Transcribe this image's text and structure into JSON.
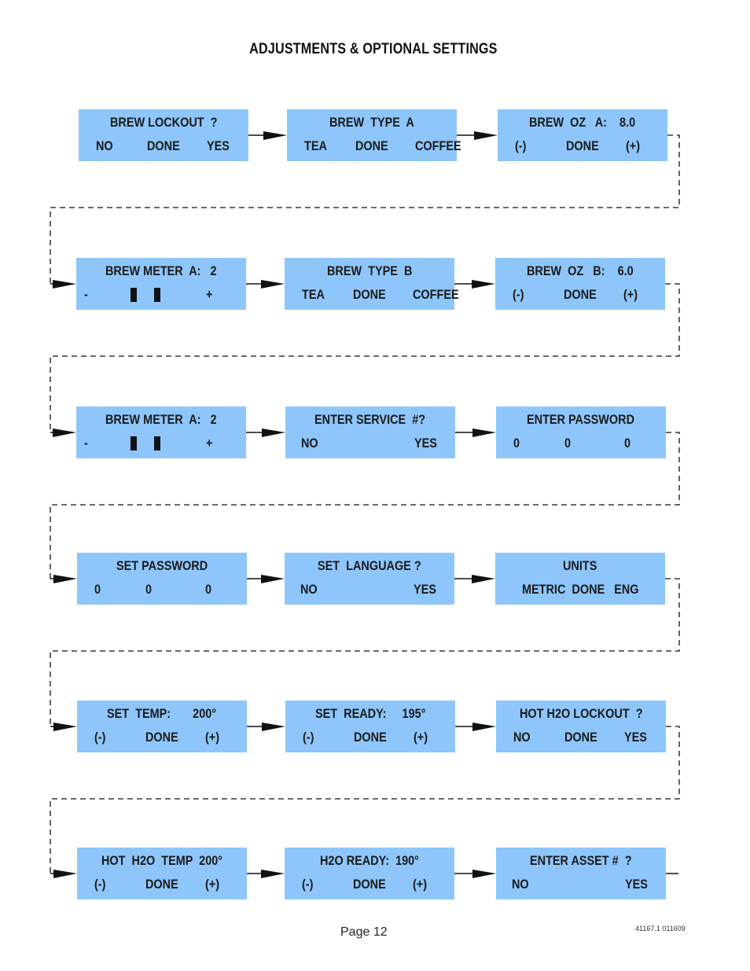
{
  "title": "ADJUSTMENTS & OPTIONAL SETTINGS",
  "screens": [
    {
      "id": "brew-lockout",
      "line1": [
        "BREW LOCKOUT  ?"
      ],
      "line2": [
        "NO",
        "DONE",
        "YES"
      ]
    },
    {
      "id": "brew-type-a",
      "line1": [
        "BREW  TYPE  A"
      ],
      "line2": [
        "TEA",
        "DONE",
        "COFFEE"
      ]
    },
    {
      "id": "brew-oz-a",
      "line1": [
        "BREW  OZ   A:    8.0"
      ],
      "line2": [
        "(-)",
        "DONE",
        "(+)"
      ]
    },
    {
      "id": "brew-meter-a-1",
      "line1": [
        "BREW METER  A:   2"
      ],
      "line2": [
        "-",
        "+"
      ],
      "meter_bars": 2
    },
    {
      "id": "brew-type-b",
      "line1": [
        "BREW  TYPE  B"
      ],
      "line2": [
        "TEA",
        "DONE",
        "COFFEE"
      ]
    },
    {
      "id": "brew-oz-b",
      "line1": [
        "BREW  OZ   B:    6.0"
      ],
      "line2": [
        "(-)",
        "DONE",
        "(+)"
      ]
    },
    {
      "id": "brew-meter-a-2",
      "line1": [
        "BREW METER  A:   2"
      ],
      "line2": [
        "-",
        "+"
      ],
      "meter_bars": 2
    },
    {
      "id": "enter-service",
      "line1": [
        "ENTER SERVICE  #?"
      ],
      "line2": [
        "NO",
        "YES"
      ]
    },
    {
      "id": "enter-password",
      "line1": [
        "ENTER PASSWORD"
      ],
      "line2": [
        "0",
        "0",
        "0"
      ]
    },
    {
      "id": "set-password",
      "line1": [
        "SET PASSWORD"
      ],
      "line2": [
        "0",
        "0",
        "0"
      ]
    },
    {
      "id": "set-language",
      "line1": [
        "SET  LANGUAGE ?"
      ],
      "line2": [
        "NO",
        "YES"
      ]
    },
    {
      "id": "units",
      "line1": [
        "UNITS"
      ],
      "line2": [
        "METRIC  DONE   ENG"
      ]
    },
    {
      "id": "set-temp",
      "line1": [
        "SET  TEMP:       200°"
      ],
      "line2": [
        "(-)",
        "DONE",
        "(+)"
      ]
    },
    {
      "id": "set-ready",
      "line1": [
        "SET  READY:     195°"
      ],
      "line2": [
        "(-)",
        "DONE",
        "(+)"
      ]
    },
    {
      "id": "hot-h2o-lockout",
      "line1": [
        "HOT H2O LOCKOUT  ?"
      ],
      "line2": [
        "NO",
        "DONE",
        "YES"
      ]
    },
    {
      "id": "hot-h2o-temp",
      "line1": [
        "HOT  H2O  TEMP  200°"
      ],
      "line2": [
        "(-)",
        "DONE",
        "(+)"
      ]
    },
    {
      "id": "h2o-ready",
      "line1": [
        "H2O READY:  190°"
      ],
      "line2": [
        "(-)",
        "DONE",
        "(+)"
      ]
    },
    {
      "id": "enter-asset",
      "line1": [
        "ENTER ASSET #  ?"
      ],
      "line2": [
        "NO",
        "YES"
      ]
    }
  ],
  "footer": {
    "page": "Page 12",
    "doc_number": "41167.1 011609"
  }
}
